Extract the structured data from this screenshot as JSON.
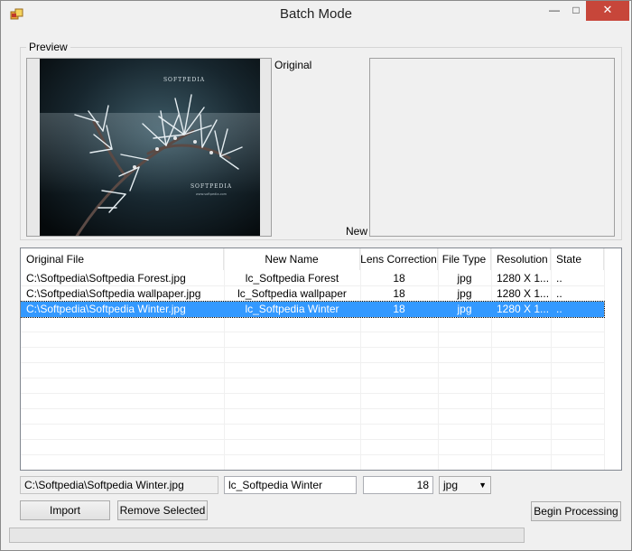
{
  "window": {
    "title": "Batch Mode",
    "controls": {
      "minimize": "—",
      "maximize": "□",
      "close": "✕"
    },
    "icon": "batch-app-icon"
  },
  "preview": {
    "legend": "Preview",
    "original_label": "Original",
    "new_label": "New",
    "watermark_top": "SOFTPEDIA",
    "watermark_bottom": "SOFTPEDIA",
    "watermark_url": "www.softpedia.com"
  },
  "table": {
    "columns": [
      "Original File",
      "New Name",
      "Lens Correction",
      "File Type",
      "Resolution",
      "State"
    ],
    "rows": [
      [
        "C:\\Softpedia\\Softpedia Forest.jpg",
        "lc_Softpedia Forest",
        "18",
        "jpg",
        "1280 X 1...",
        ".."
      ],
      [
        "C:\\Softpedia\\Softpedia wallpaper.jpg",
        "lc_Softpedia wallpaper",
        "18",
        "jpg",
        "1280 X 1...",
        ".."
      ],
      [
        "C:\\Softpedia\\Softpedia Winter.jpg",
        "lc_Softpedia Winter",
        "18",
        "jpg",
        "1280 X 1...",
        ".."
      ]
    ],
    "selected_index": 2
  },
  "editor": {
    "original_path": "C:\\Softpedia\\Softpedia Winter.jpg",
    "new_name": "lc_Softpedia Winter",
    "lens_correction": "18",
    "file_type": "jpg"
  },
  "buttons": {
    "import": "Import",
    "remove_selected": "Remove Selected",
    "begin_processing": "Begin Processing"
  },
  "progress": {
    "value": 0
  },
  "colors": {
    "selection": "#3399ff",
    "close": "#c7463a",
    "progress": "#06b025"
  }
}
